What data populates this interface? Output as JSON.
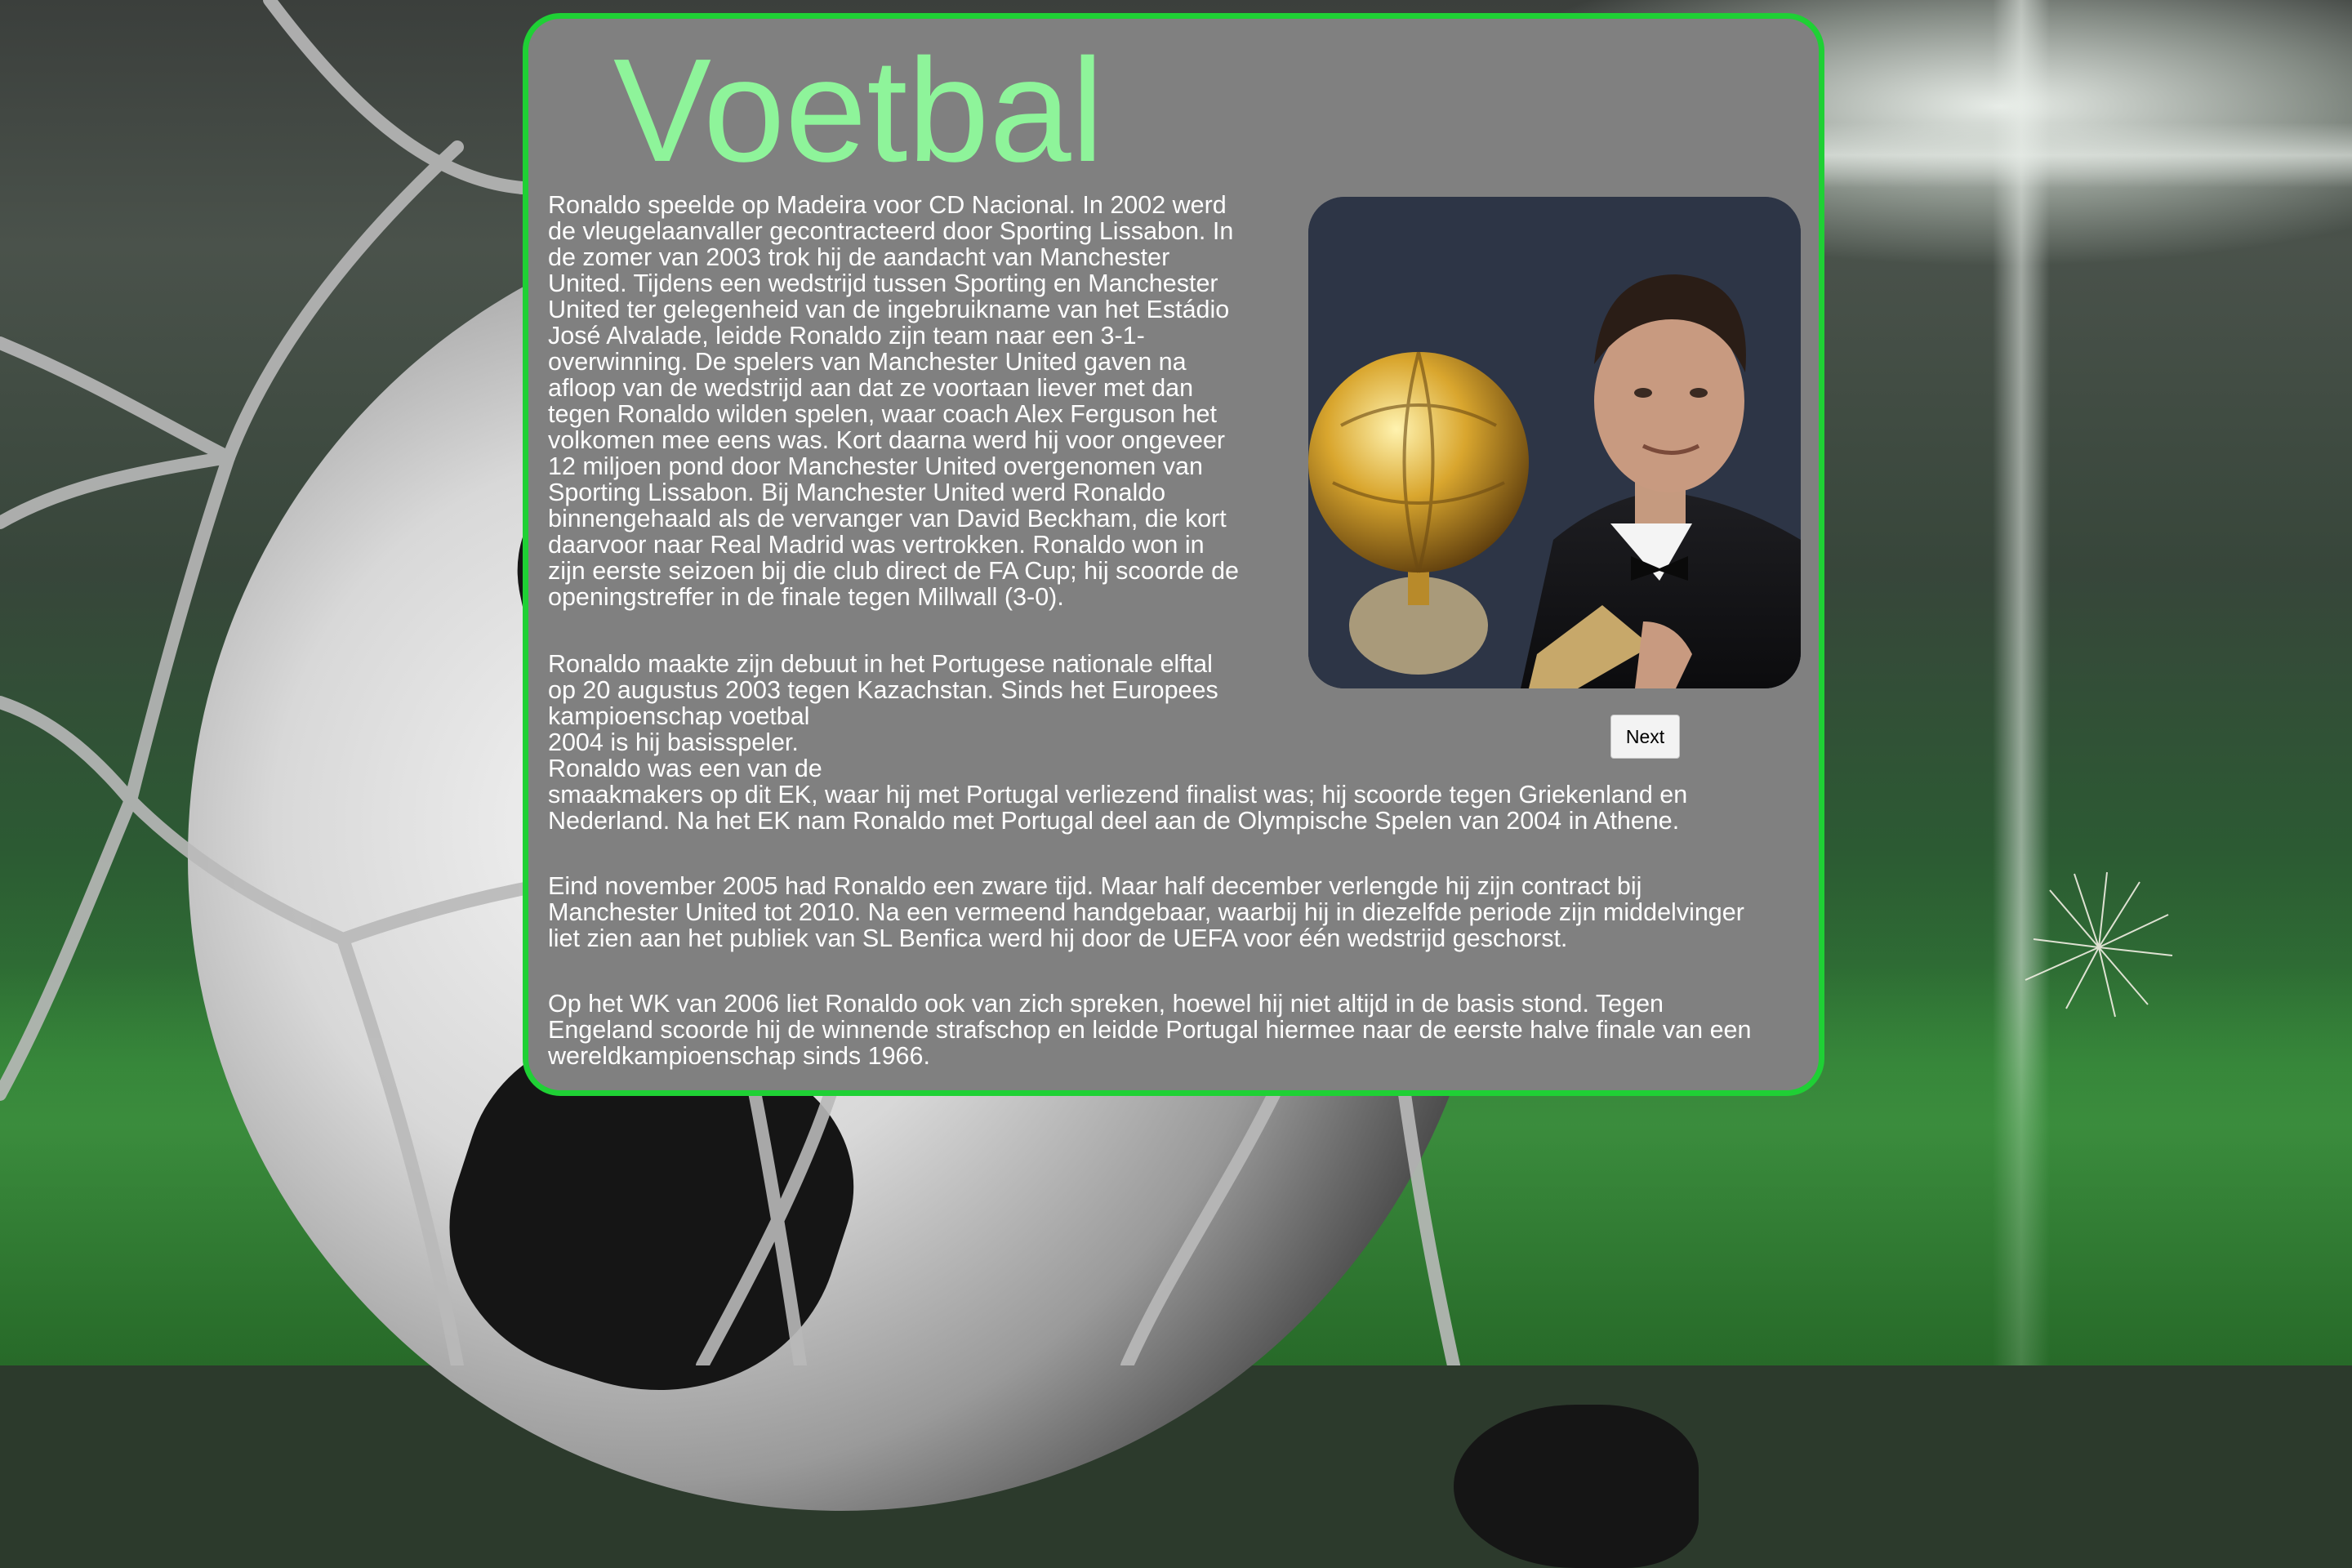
{
  "title": "Voetbal",
  "next_label": "Next",
  "photo": {
    "icon": "ronaldo-ballon-dor-photo"
  },
  "colors": {
    "panel_border": "#1fd035",
    "panel_bg": "#808080",
    "title": "#8ef49a",
    "text": "#ffffff"
  },
  "paragraphs": [
    {
      "lines": [
        "Ronaldo speelde op Madeira voor CD Nacional. In 2002 werd",
        "de vleugelaanvaller gecontracteerd door Sporting Lissabon. In",
        "de zomer van 2003 trok hij de aandacht van Manchester",
        "United. Tijdens een wedstrijd tussen Sporting en Manchester",
        "United ter gelegenheid van de ingebruikname van het Estádio",
        "José Alvalade, leidde Ronaldo zijn team naar een 3-1-",
        "overwinning. De spelers van Manchester United gaven na",
        "afloop van de wedstrijd aan dat ze voortaan liever met dan",
        "tegen Ronaldo wilden spelen, waar coach Alex Ferguson het",
        "volkomen mee eens was. Kort daarna werd hij voor ongeveer",
        "12 miljoen pond door Manchester United overgenomen van",
        "Sporting Lissabon. Bij Manchester United werd Ronaldo",
        "binnengehaald als de vervanger van David Beckham, die kort",
        "daarvoor naar Real Madrid was vertrokken. Ronaldo won in",
        "zijn eerste seizoen bij die club direct de FA Cup; hij scoorde de",
        "openingstreffer in de finale tegen Millwall (3-0)."
      ]
    },
    {
      "lines": [
        "Ronaldo maakte zijn debuut in het Portugese nationale elftal",
        "op 20 augustus 2003 tegen Kazachstan. Sinds het Europees",
        "kampioenschap voetbal",
        "2004 is hij basisspeler.",
        "Ronaldo was een van de",
        "smaakmakers op dit EK, waar hij met Portugal verliezend finalist was; hij scoorde tegen Griekenland en",
        "Nederland. Na het EK nam Ronaldo met Portugal deel aan de Olympische Spelen van 2004 in Athene."
      ]
    },
    {
      "lines": [
        "Eind november 2005 had Ronaldo een zware tijd. Maar half december verlengde hij zijn contract bij",
        "Manchester United tot 2010. Na een vermeend handgebaar, waarbij hij in diezelfde periode zijn middelvinger",
        "liet zien aan het publiek van SL Benfica werd hij door de UEFA voor één wedstrijd geschorst."
      ]
    },
    {
      "lines": [
        "Op het WK van 2006 liet Ronaldo ook van zich spreken, hoewel hij niet altijd in de basis stond. Tegen",
        "Engeland scoorde hij de winnende strafschop en leidde Portugal hiermee naar de eerste halve finale van een",
        "wereldkampioenschap sinds 1966."
      ]
    }
  ]
}
